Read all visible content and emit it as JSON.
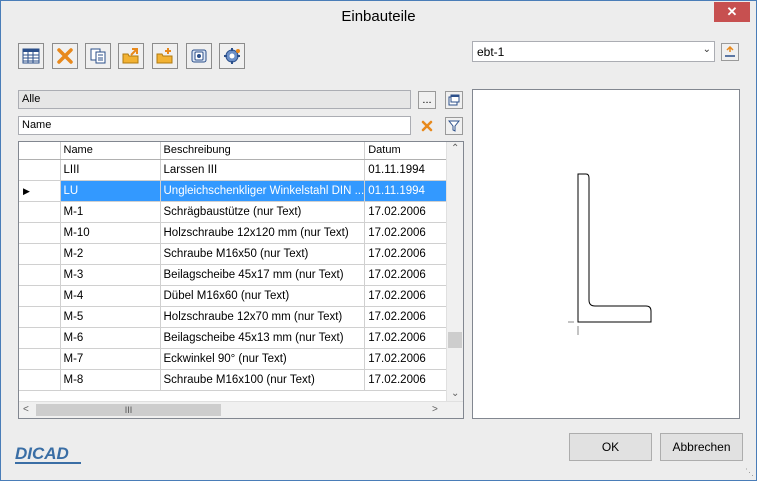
{
  "window": {
    "title": "Einbauteile",
    "close_label": "✕"
  },
  "toolbar": {
    "buttons": [
      {
        "icon": "table-icon"
      },
      {
        "icon": "delete-icon"
      },
      {
        "icon": "copy-icon"
      },
      {
        "icon": "folder-export-icon"
      },
      {
        "icon": "folder-add-icon"
      },
      {
        "icon": "import-icon"
      },
      {
        "icon": "settings-icon"
      }
    ]
  },
  "variant_select": {
    "value": "ebt-1"
  },
  "filter": {
    "category_value": "Alle",
    "category_button": "...",
    "name_value": "Name"
  },
  "table": {
    "columns": [
      "Name",
      "Beschreibung",
      "Datum"
    ],
    "rows": [
      {
        "name": "LIII",
        "beschreibung": "Larssen III",
        "datum": "01.11.1994"
      },
      {
        "name": "LU",
        "beschreibung": "Ungleichschenkliger Winkelstahl DIN ...",
        "datum": "01.11.1994",
        "selected": true
      },
      {
        "name": "M-1",
        "beschreibung": "Schrägbaustütze (nur Text)",
        "datum": "17.02.2006"
      },
      {
        "name": "M-10",
        "beschreibung": "Holzschraube 12x120 mm (nur Text)",
        "datum": "17.02.2006"
      },
      {
        "name": "M-2",
        "beschreibung": "Schraube M16x50 (nur Text)",
        "datum": "17.02.2006"
      },
      {
        "name": "M-3",
        "beschreibung": "Beilagscheibe 45x17 mm (nur Text)",
        "datum": "17.02.2006"
      },
      {
        "name": "M-4",
        "beschreibung": "Dübel M16x60 (nur Text)",
        "datum": "17.02.2006"
      },
      {
        "name": "M-5",
        "beschreibung": "Holzschraube 12x70 mm (nur Text)",
        "datum": "17.02.2006"
      },
      {
        "name": "M-6",
        "beschreibung": "Beilagscheibe 45x13 mm (nur Text)",
        "datum": "17.02.2006"
      },
      {
        "name": "M-7",
        "beschreibung": "Eckwinkel 90° (nur Text)",
        "datum": "17.02.2006"
      },
      {
        "name": "M-8",
        "beschreibung": "Schraube M16x100 (nur Text)",
        "datum": "17.02.2006"
      }
    ],
    "hscroll_thumb": "III"
  },
  "buttons": {
    "ok": "OK",
    "cancel": "Abbrechen"
  },
  "logo": "DICAD"
}
